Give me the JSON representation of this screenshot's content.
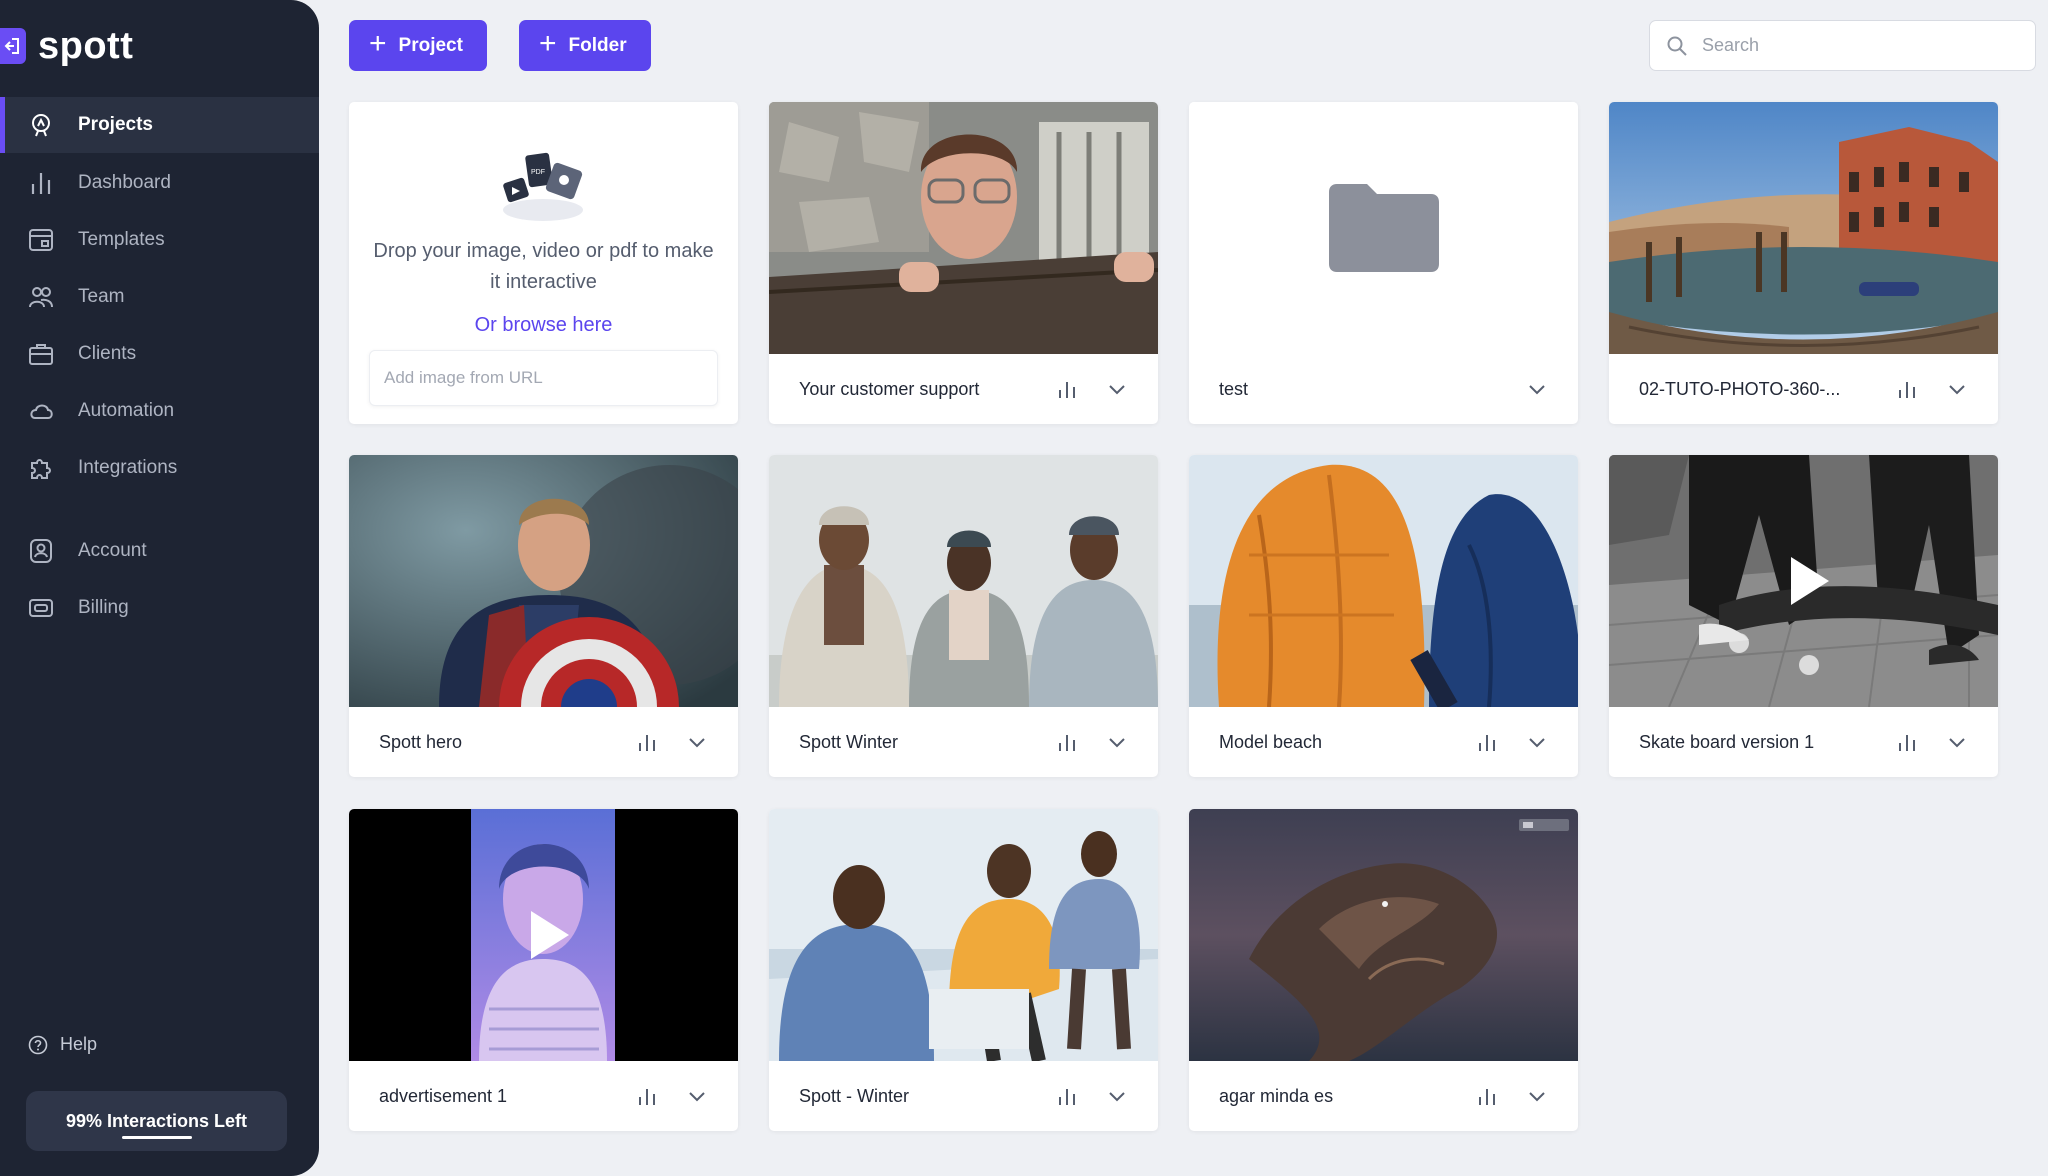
{
  "app": {
    "logo_text": "spott",
    "accent": "#5b45ee",
    "sidebar_bg": "#1e2433"
  },
  "sidebar": {
    "items": [
      {
        "label": "Projects",
        "icon": "rocket-icon",
        "active": true
      },
      {
        "label": "Dashboard",
        "icon": "bar-chart-icon"
      },
      {
        "label": "Templates",
        "icon": "template-icon"
      },
      {
        "label": "Team",
        "icon": "team-icon"
      },
      {
        "label": "Clients",
        "icon": "briefcase-icon"
      },
      {
        "label": "Automation",
        "icon": "cloud-icon"
      },
      {
        "label": "Integrations",
        "icon": "puzzle-icon"
      },
      {
        "label": "Account",
        "icon": "user-shield-icon"
      },
      {
        "label": "Billing",
        "icon": "credit-card-icon"
      }
    ],
    "help_label": "Help",
    "interactions_label": "99% Interactions Left"
  },
  "toolbar": {
    "project_label": "Project",
    "folder_label": "Folder"
  },
  "search": {
    "placeholder": "Search"
  },
  "upload": {
    "text": "Drop your image, video or pdf to make it interactive",
    "browse_label": "Or browse here",
    "url_placeholder": "Add image from URL"
  },
  "cards": [
    {
      "title": "Your customer support",
      "type": "image",
      "stats": true
    },
    {
      "title": "test",
      "type": "folder",
      "stats": false
    },
    {
      "title": "02-TUTO-PHOTO-360-...",
      "type": "image",
      "stats": true
    },
    {
      "title": "Spott hero",
      "type": "image",
      "stats": true
    },
    {
      "title": "Spott Winter",
      "type": "image",
      "stats": true
    },
    {
      "title": "Model beach",
      "type": "image",
      "stats": true
    },
    {
      "title": "Skate board version 1",
      "type": "video",
      "stats": true
    },
    {
      "title": "advertisement 1",
      "type": "video",
      "stats": true
    },
    {
      "title": "Spott - Winter",
      "type": "image",
      "stats": true
    },
    {
      "title": "agar minda es",
      "type": "image",
      "stats": true
    }
  ]
}
